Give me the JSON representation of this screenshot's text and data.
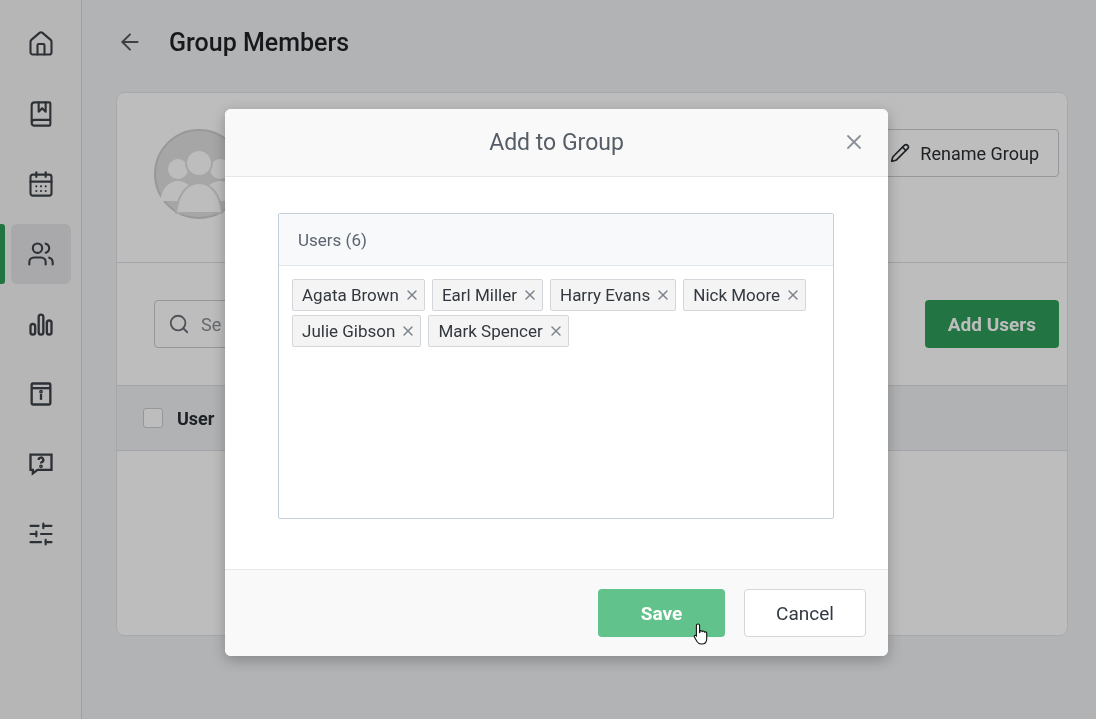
{
  "sidebar": {
    "items": [
      {
        "selected": false
      },
      {
        "selected": false
      },
      {
        "selected": false
      },
      {
        "selected": true
      },
      {
        "selected": false
      },
      {
        "selected": false
      },
      {
        "selected": false
      },
      {
        "selected": false
      }
    ]
  },
  "page": {
    "title": "Group Members"
  },
  "group_card": {
    "rename_button": "Rename Group",
    "search": {
      "placeholder": "Se"
    },
    "add_button": "Add Users",
    "table": {
      "select_all_checked": false,
      "columns": [
        "User"
      ]
    }
  },
  "dialog": {
    "title": "Add to Group",
    "users_header": "Users (6)",
    "users": [
      {
        "name": "Agata Brown"
      },
      {
        "name": "Earl Miller"
      },
      {
        "name": "Harry Evans"
      },
      {
        "name": "Nick Moore"
      },
      {
        "name": "Julie Gibson"
      },
      {
        "name": "Mark Spencer"
      }
    ],
    "buttons": [
      {
        "label": "Save",
        "kind": "primary"
      },
      {
        "label": "Cancel",
        "kind": "secondary"
      }
    ]
  }
}
